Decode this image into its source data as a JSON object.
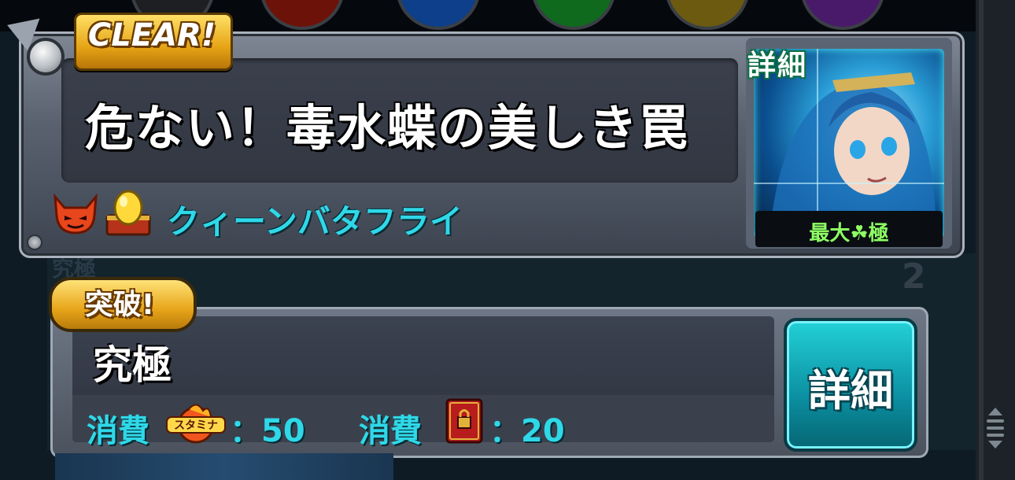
{
  "quest": {
    "badge": "CLEAR!",
    "title": "危ない！毒水蝶の美しき罠",
    "boss_name": "クィーンバタフライ",
    "portrait": {
      "detail_label": "詳細",
      "max_label": "最大☘極"
    }
  },
  "difficulty": {
    "badge": "突破!",
    "name": "究極",
    "faint_label": "究極",
    "index": "2",
    "stamina_cost_label": "消費",
    "stamina_value": "：50",
    "book_cost_label": "消費",
    "book_value": "：20",
    "detail_button": "詳細"
  },
  "icons": {
    "element": "devil-face-icon",
    "reward": "golden-egg-chest-icon",
    "stamina": "stamina-flame-icon",
    "book": "red-lock-book-icon",
    "bolt": "metal-bolt-icon"
  },
  "colors": {
    "accent_cyan": "#2fd8e8",
    "gold": "#e6a415",
    "max_green": "#8dff63",
    "detail_button": "#23d1d6"
  }
}
